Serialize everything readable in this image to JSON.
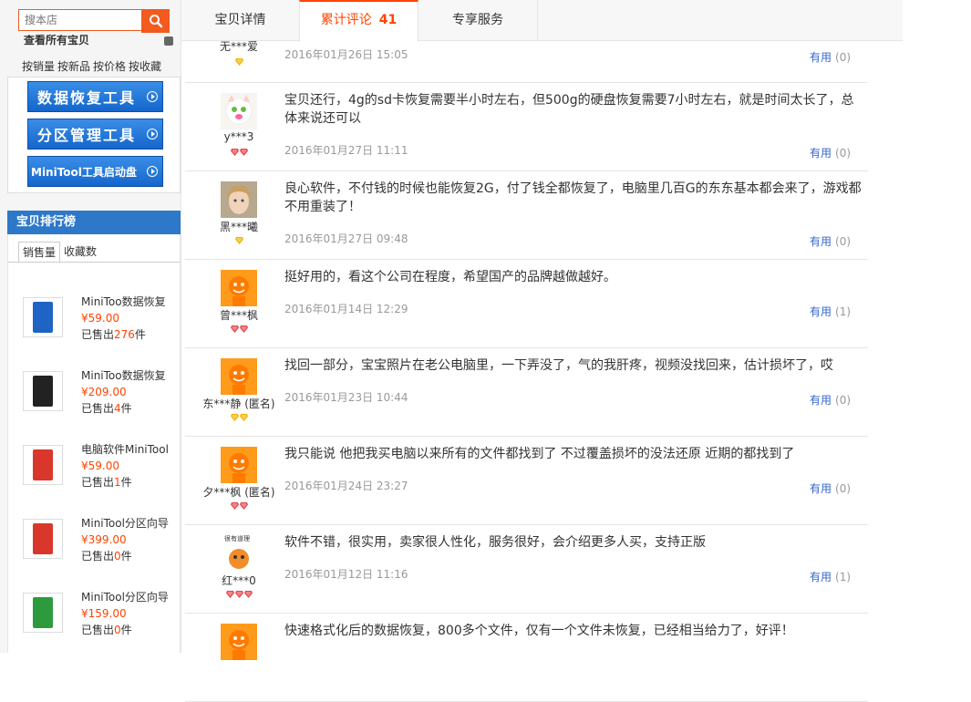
{
  "search": {
    "placeholder": "搜本店"
  },
  "sidebar": {
    "category_title": "查看所有宝贝",
    "sort_links": [
      "按销量",
      "按新品",
      "按价格",
      "按收藏"
    ],
    "banners": [
      "数据恢复工具",
      "分区管理工具",
      "MiniTool工具启动盘"
    ]
  },
  "ranking": {
    "title": "宝贝排行榜",
    "tabs": [
      "销售量",
      "收藏数"
    ],
    "sold_prefix": "已售出",
    "sold_suffix": "件",
    "items": [
      {
        "name": "MiniToo数据恢复",
        "price": "¥59.00",
        "sold": "276",
        "color": "#1f63c4"
      },
      {
        "name": "MiniToo数据恢复",
        "price": "¥209.00",
        "sold": "4",
        "color": "#222222"
      },
      {
        "name": "电脑软件MiniTool",
        "price": "¥59.00",
        "sold": "1",
        "color": "#d9372b"
      },
      {
        "name": "MiniTool分区向导",
        "price": "¥399.00",
        "sold": "0",
        "color": "#d9372b"
      },
      {
        "name": "MiniTool分区向导",
        "price": "¥159.00",
        "sold": "0",
        "color": "#2e9a3e"
      }
    ]
  },
  "tabs": [
    {
      "label": "宝贝详情"
    },
    {
      "label": "累计评论",
      "count": "41"
    },
    {
      "label": "专享服务"
    }
  ],
  "useful_label": "有用",
  "reviews": [
    {
      "nick": "无***爱",
      "avatar": "none",
      "level": [
        "gold"
      ],
      "content": "",
      "date": "2016年01月26日 15:05",
      "useful": "(0)"
    },
    {
      "nick": "y***3",
      "avatar": "cat",
      "level": [
        "red",
        "red"
      ],
      "content": "宝贝还行，4g的sd卡恢复需要半小时左右，但500g的硬盘恢复需要7小时左右，就是时间太长了，总体来说还可以",
      "date": "2016年01月27日 11:11",
      "useful": "(0)"
    },
    {
      "nick": "黑***曦",
      "avatar": "photo",
      "level": [
        "gold"
      ],
      "content": "良心软件，不付钱的时候也能恢复2G，付了钱全都恢复了，电脑里几百G的东东基本都会来了，游戏都不用重装了！",
      "date": "2016年01月27日 09:48",
      "useful": "(0)"
    },
    {
      "nick": "曾***枫",
      "avatar": "default",
      "level": [
        "red",
        "red"
      ],
      "content": "挺好用的，看这个公司在程度，希望国产的品牌越做越好。",
      "date": "2016年01月14日 12:29",
      "useful": "(1)"
    },
    {
      "nick": "东***静 (匿名)",
      "avatar": "default",
      "level": [
        "gold",
        "gold"
      ],
      "content": "找回一部分，宝宝照片在老公电脑里，一下弄没了，气的我肝疼，视频没找回来，估计损坏了，哎",
      "date": "2016年01月23日 10:44",
      "useful": "(0)"
    },
    {
      "nick": "夕***枫 (匿名)",
      "avatar": "default",
      "level": [
        "red",
        "red"
      ],
      "content": "我只能说 他把我买电脑以来所有的文件都找到了 不过覆盖损坏的没法还原 近期的都找到了",
      "date": "2016年01月24日 23:27",
      "useful": "(0)"
    },
    {
      "nick": "红***0",
      "avatar": "cartoon",
      "level": [
        "red",
        "red",
        "red"
      ],
      "content": "软件不错，很实用，卖家很人性化，服务很好，会介绍更多人买，支持正版",
      "date": "2016年01月12日 11:16",
      "useful": "(1)"
    },
    {
      "nick": "",
      "avatar": "default",
      "level": [],
      "content": "快速格式化后的数据恢复，800多个文件，仅有一个文件未恢复，已经相当给力了，好评！",
      "date": "",
      "useful": ""
    }
  ],
  "avatar_badge_text": "很有道理"
}
